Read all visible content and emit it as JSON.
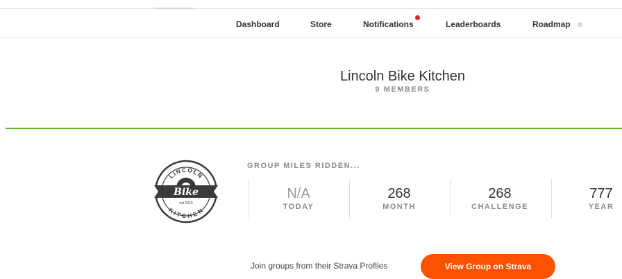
{
  "nav": {
    "items": [
      {
        "label": "Dashboard"
      },
      {
        "label": "Store"
      },
      {
        "label": "Notifications"
      },
      {
        "label": "Leaderboards"
      },
      {
        "label": "Roadmap"
      }
    ],
    "notification_dot_color": "#e0201c"
  },
  "group": {
    "name": "Lincoln Bike Kitchen",
    "members": "9 MEMBERS",
    "logo": {
      "top_text": "LINCOLN",
      "center_text": "Bike",
      "small_text": "est 2010",
      "bottom_text": "KITCHEN"
    }
  },
  "stats": {
    "title": "GROUP MILES RIDDEN...",
    "items": [
      {
        "value": "N/A",
        "label": "TODAY"
      },
      {
        "value": "268",
        "label": "MONTH"
      },
      {
        "value": "268",
        "label": "CHALLENGE"
      },
      {
        "value": "777",
        "label": "YEAR"
      }
    ]
  },
  "join": {
    "text": "Join groups from their Strava Profiles",
    "button_label": "View Group on Strava",
    "button_color": "#fc5200"
  },
  "colors": {
    "accent_green": "#6ab72a"
  }
}
